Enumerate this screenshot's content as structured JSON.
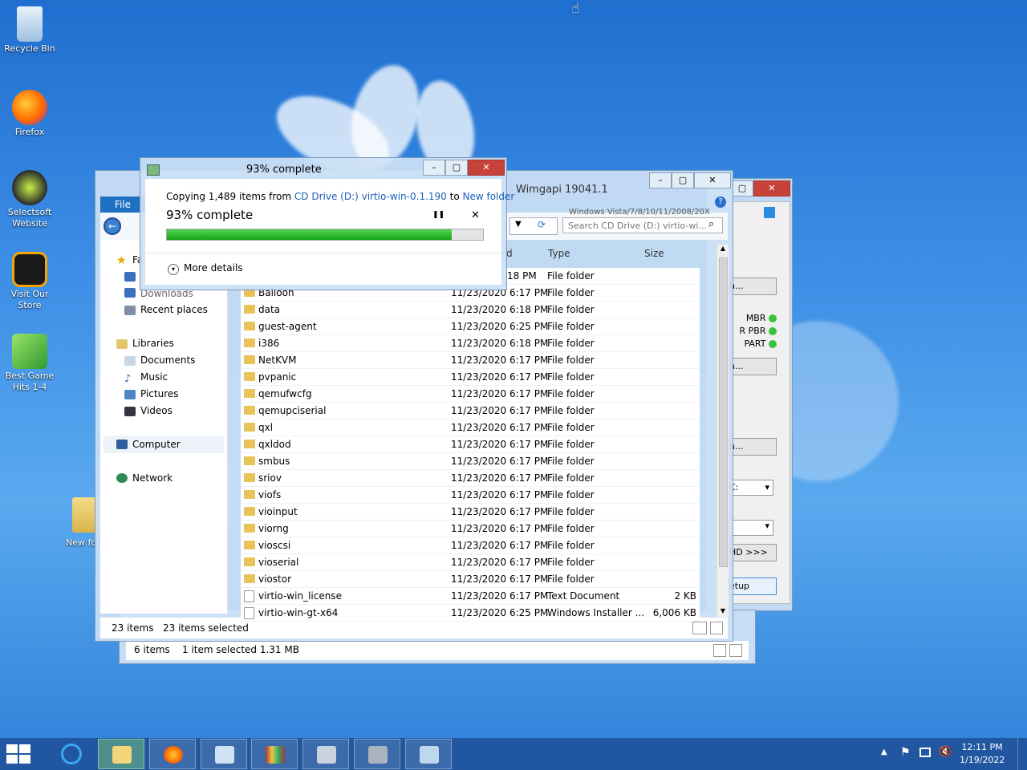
{
  "desktop": {
    "icons": [
      {
        "label": "Recycle Bin"
      },
      {
        "label": "Firefox"
      },
      {
        "label": "Selectsoft Website"
      },
      {
        "label": "Visit Our Store"
      },
      {
        "label": "Best Game Hits 1-4"
      },
      {
        "label": "New fol"
      }
    ]
  },
  "progress_dialog": {
    "title": "93% complete",
    "copy_prefix": "Copying 1,489 items from ",
    "source": "CD Drive (D:) virtio-win-0.1.190",
    "copy_to": " to ",
    "destination": "New folder",
    "percent_text": "93% complete",
    "progress": 0.9,
    "more_details": "More details",
    "pause_glyph": "❚❚",
    "close_glyph": "✕"
  },
  "explorer": {
    "title": "Wimgapi 19041.1",
    "file_tab": "File",
    "address_partial": "Windows Vista/7/8/10/11/2008/20X",
    "search_placeholder": "Search CD Drive (D:) virtio-wi...",
    "columns": {
      "date_partial": "d",
      "type": "Type",
      "size": "Size"
    },
    "nav": {
      "favorites_partial": "Fa",
      "downloads": "Downloads",
      "recent": "Recent places",
      "libraries": "Libraries",
      "documents": "Documents",
      "music": "Music",
      "pictures": "Pictures",
      "videos": "Videos",
      "computer": "Computer",
      "network": "Network"
    },
    "rows": [
      {
        "name": "",
        "date": "18 PM",
        "type": "File folder",
        "size": ""
      },
      {
        "name": "Balloon",
        "date": "11/23/2020 6:17 PM",
        "type": "File folder",
        "size": ""
      },
      {
        "name": "data",
        "date": "11/23/2020 6:18 PM",
        "type": "File folder",
        "size": ""
      },
      {
        "name": "guest-agent",
        "date": "11/23/2020 6:25 PM",
        "type": "File folder",
        "size": ""
      },
      {
        "name": "i386",
        "date": "11/23/2020 6:18 PM",
        "type": "File folder",
        "size": ""
      },
      {
        "name": "NetKVM",
        "date": "11/23/2020 6:17 PM",
        "type": "File folder",
        "size": ""
      },
      {
        "name": "pvpanic",
        "date": "11/23/2020 6:17 PM",
        "type": "File folder",
        "size": ""
      },
      {
        "name": "qemufwcfg",
        "date": "11/23/2020 6:17 PM",
        "type": "File folder",
        "size": ""
      },
      {
        "name": "qemupciserial",
        "date": "11/23/2020 6:17 PM",
        "type": "File folder",
        "size": ""
      },
      {
        "name": "qxl",
        "date": "11/23/2020 6:17 PM",
        "type": "File folder",
        "size": ""
      },
      {
        "name": "qxldod",
        "date": "11/23/2020 6:17 PM",
        "type": "File folder",
        "size": ""
      },
      {
        "name": "smbus",
        "date": "11/23/2020 6:17 PM",
        "type": "File folder",
        "size": ""
      },
      {
        "name": "sriov",
        "date": "11/23/2020 6:17 PM",
        "type": "File folder",
        "size": ""
      },
      {
        "name": "viofs",
        "date": "11/23/2020 6:17 PM",
        "type": "File folder",
        "size": ""
      },
      {
        "name": "vioinput",
        "date": "11/23/2020 6:17 PM",
        "type": "File folder",
        "size": ""
      },
      {
        "name": "viorng",
        "date": "11/23/2020 6:17 PM",
        "type": "File folder",
        "size": ""
      },
      {
        "name": "vioscsi",
        "date": "11/23/2020 6:17 PM",
        "type": "File folder",
        "size": ""
      },
      {
        "name": "vioserial",
        "date": "11/23/2020 6:17 PM",
        "type": "File folder",
        "size": ""
      },
      {
        "name": "viostor",
        "date": "11/23/2020 6:17 PM",
        "type": "File folder",
        "size": ""
      },
      {
        "name": "virtio-win_license",
        "date": "11/23/2020 6:17 PM",
        "type": "Text Document",
        "size": "2 KB"
      },
      {
        "name": "virtio-win-gt-x64",
        "date": "11/23/2020 6:25 PM",
        "type": "Windows Installer ...",
        "size": "6,006 KB"
      }
    ],
    "status_count": "23 items",
    "status_selected": "23 items selected"
  },
  "back_explorer": {
    "status_count": "6 items",
    "status_selected": "1 item selected  1.31 MB"
  },
  "right_app": {
    "btn1": "h...",
    "mbr": "MBR",
    "pbr": "R PBR",
    "part": "PART",
    "btn2": "h...",
    "btn3": "h...",
    "drive": "C:",
    "vhd_btn": "HD >>>",
    "setup_btn": "etup"
  },
  "taskbar": {
    "time": "12:11 PM",
    "date": "1/19/2022"
  }
}
